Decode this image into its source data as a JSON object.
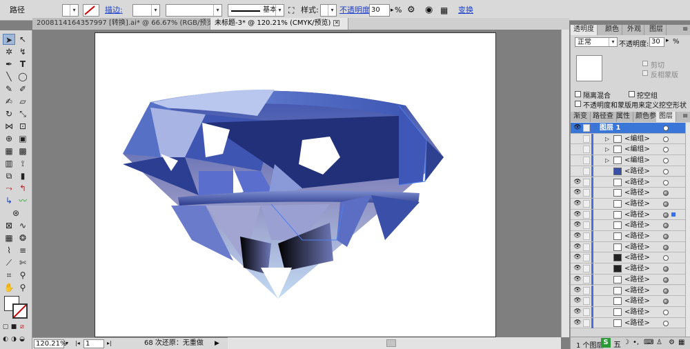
{
  "control_bar": {
    "object_type": "路径",
    "stroke_label": "描边:",
    "brush_label": "基本",
    "style_label": "样式:",
    "opacity_label": "不透明度:",
    "opacity_value": "30",
    "percent_sign": "%",
    "transform_label": "变换"
  },
  "tabs": [
    {
      "label": "2008114164357997 [转换].ai* @ 66.67% (RGB/预览)"
    },
    {
      "label": "未标题-3* @ 120.21% (CMYK/预览)"
    }
  ],
  "status": {
    "zoom": "120.21%",
    "page": "1",
    "undo_text": "68 次还原：无重做"
  },
  "transparency_panel": {
    "tabs": [
      "透明度",
      "颜色",
      "外观",
      "图层"
    ],
    "blend_mode": "正常",
    "opacity_label": "不透明度:",
    "opacity_value": "30",
    "clip_label": "剪切",
    "invert_mask_label": "反相蒙版",
    "isolate_label": "隔离混合",
    "knockout_label": "挖空组",
    "define_knockout_label": "不透明度和蒙版用来定义挖空形状"
  },
  "layers_panel": {
    "tabs": [
      "渐变",
      "路径查",
      "属性",
      "颜色参",
      "图层"
    ],
    "footer": "1 个图层",
    "rows": [
      {
        "name": "图层 1",
        "highlight": true
      },
      {
        "name": "<编组>"
      },
      {
        "name": "<编组>"
      },
      {
        "name": "<编组>"
      },
      {
        "name": "<路径>"
      },
      {
        "name": "<路径>"
      },
      {
        "name": "<路径>"
      },
      {
        "name": "<路径>"
      },
      {
        "name": "<路径>"
      },
      {
        "name": "<路径>"
      },
      {
        "name": "<路径>"
      },
      {
        "name": "<路径>"
      },
      {
        "name": "<路径>"
      },
      {
        "name": "<路径>"
      },
      {
        "name": "<路径>"
      },
      {
        "name": "<路径>"
      },
      {
        "name": "<路径>"
      },
      {
        "name": "<路径>"
      },
      {
        "name": "<路径>"
      }
    ]
  },
  "tray": {
    "ime_label": "五"
  },
  "colors": {
    "accent": "#1a3fd0",
    "layer_color": "#4a6fd8",
    "gem_dark": "#22307a",
    "gem_light": "#a7b4e4"
  }
}
